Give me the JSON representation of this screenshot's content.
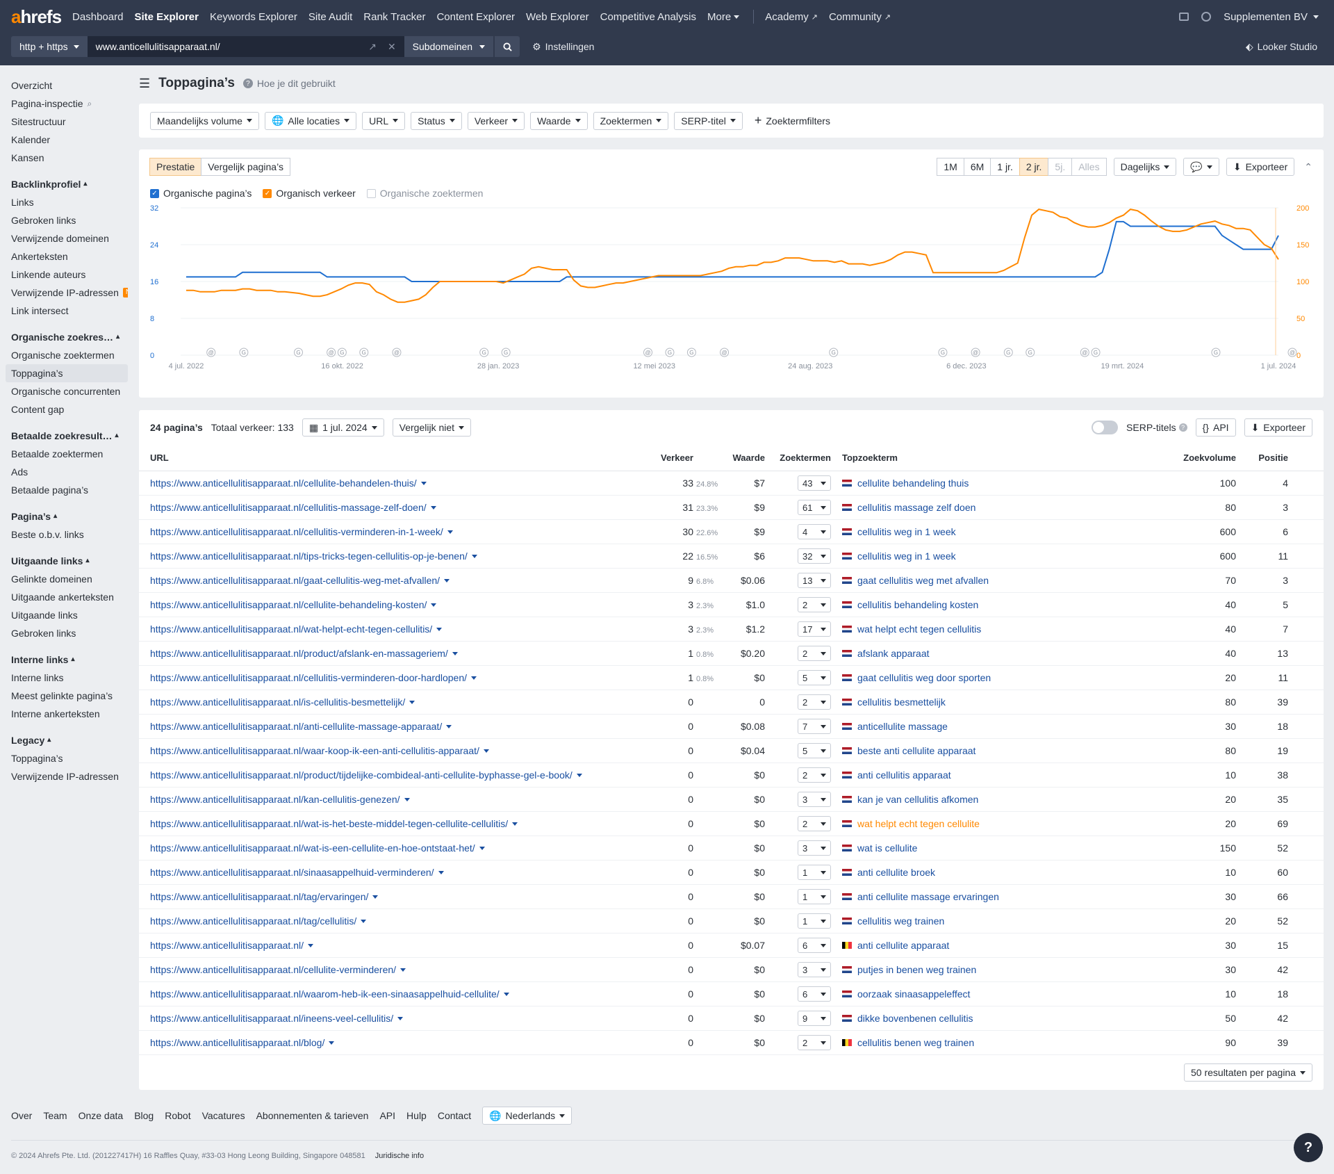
{
  "brand": {
    "logo_a": "a",
    "logo_rest": "hrefs"
  },
  "nav": {
    "items": [
      {
        "label": "Dashboard",
        "active": false
      },
      {
        "label": "Site Explorer",
        "active": true
      },
      {
        "label": "Keywords Explorer",
        "active": false
      },
      {
        "label": "Site Audit",
        "active": false
      },
      {
        "label": "Rank Tracker",
        "active": false
      },
      {
        "label": "Content Explorer",
        "active": false
      },
      {
        "label": "Web Explorer",
        "active": false
      },
      {
        "label": "Competitive Analysis",
        "active": false
      },
      {
        "label": "More",
        "active": false
      }
    ],
    "academy": "Academy",
    "community": "Community",
    "account": "Supplementen BV",
    "looker": "Looker Studio"
  },
  "searchbar": {
    "protocol": "http + https",
    "url": "www.anticellulitisapparaat.nl/",
    "mode": "Subdomeinen",
    "settings": "Instellingen"
  },
  "sidebar": [
    {
      "type": "item",
      "label": "Overzicht"
    },
    {
      "type": "item",
      "label": "Pagina-inspectie",
      "icon": "search"
    },
    {
      "type": "item",
      "label": "Sitestructuur"
    },
    {
      "type": "item",
      "label": "Kalender"
    },
    {
      "type": "item",
      "label": "Kansen"
    },
    {
      "type": "head",
      "label": "Backlinkprofiel"
    },
    {
      "type": "item",
      "label": "Links"
    },
    {
      "type": "item",
      "label": "Gebroken links"
    },
    {
      "type": "item",
      "label": "Verwijzende domeinen"
    },
    {
      "type": "item",
      "label": "Ankerteksten"
    },
    {
      "type": "item",
      "label": "Linkende auteurs"
    },
    {
      "type": "item",
      "label": "Verwijzende IP-adressen",
      "badge": "Nieuw"
    },
    {
      "type": "item",
      "label": "Link intersect"
    },
    {
      "type": "head",
      "label": "Organische zoekres…"
    },
    {
      "type": "item",
      "label": "Organische zoektermen"
    },
    {
      "type": "item",
      "label": "Toppagina’s",
      "selected": true
    },
    {
      "type": "item",
      "label": "Organische concurrenten"
    },
    {
      "type": "item",
      "label": "Content gap"
    },
    {
      "type": "head",
      "label": "Betaalde zoekresult…"
    },
    {
      "type": "item",
      "label": "Betaalde zoektermen"
    },
    {
      "type": "item",
      "label": "Ads"
    },
    {
      "type": "item",
      "label": "Betaalde pagina’s"
    },
    {
      "type": "head",
      "label": "Pagina’s"
    },
    {
      "type": "item",
      "label": "Beste o.b.v. links"
    },
    {
      "type": "head",
      "label": "Uitgaande links"
    },
    {
      "type": "item",
      "label": "Gelinkte domeinen"
    },
    {
      "type": "item",
      "label": "Uitgaande ankerteksten"
    },
    {
      "type": "item",
      "label": "Uitgaande links"
    },
    {
      "type": "item",
      "label": "Gebroken links"
    },
    {
      "type": "head",
      "label": "Interne links"
    },
    {
      "type": "item",
      "label": "Interne links"
    },
    {
      "type": "item",
      "label": "Meest gelinkte pagina’s"
    },
    {
      "type": "item",
      "label": "Interne ankerteksten"
    },
    {
      "type": "head",
      "label": "Legacy"
    },
    {
      "type": "item",
      "label": "Toppagina’s"
    },
    {
      "type": "item",
      "label": "Verwijzende IP-adressen"
    }
  ],
  "page": {
    "title": "Toppagina’s",
    "help": "Hoe je dit gebruikt"
  },
  "filters": [
    "Maandelijks volume",
    "Alle locaties",
    "URL",
    "Status",
    "Verkeer",
    "Waarde",
    "Zoektermen",
    "SERP-titel"
  ],
  "filter_add": "Zoektermfilters",
  "chart_panel": {
    "tabs": [
      "Prestatie",
      "Vergelijk pagina’s"
    ],
    "ranges": [
      {
        "l": "1M",
        "s": ""
      },
      {
        "l": "6M",
        "s": ""
      },
      {
        "l": "1 jr.",
        "s": ""
      },
      {
        "l": "2 jr.",
        "s": "on"
      },
      {
        "l": "5j.",
        "s": "dis"
      },
      {
        "l": "Alles",
        "s": "dis"
      }
    ],
    "interval": "Dagelijks",
    "export": "Exporteer",
    "legend": [
      {
        "label": "Organische pagina’s",
        "color": "#1f6fd0",
        "checked": true
      },
      {
        "label": "Organisch verkeer",
        "color": "#ff8800",
        "checked": true
      },
      {
        "label": "Organische zoektermen",
        "color": "#b3b8c0",
        "checked": false
      }
    ]
  },
  "chart_data": {
    "type": "line",
    "x_ticks": [
      "4 jul. 2022",
      "16 okt. 2022",
      "28 jan. 2023",
      "12 mei 2023",
      "24 aug. 2023",
      "6 dec. 2023",
      "19 mrt. 2024",
      "1 jul. 2024"
    ],
    "y_left_ticks": [
      "32",
      "24",
      "16",
      "8",
      "0"
    ],
    "y_right_ticks": [
      "200",
      "150",
      "100",
      "50",
      "0"
    ],
    "y_left_lim": [
      0,
      32
    ],
    "y_right_lim": [
      0,
      200
    ],
    "series": [
      {
        "name": "Organische pagina’s",
        "axis": "left",
        "color": "#1f6fd0",
        "values": [
          17,
          17,
          17,
          17,
          17,
          17,
          17,
          17,
          18,
          18,
          18,
          18,
          18,
          18,
          18,
          18,
          18,
          18,
          18,
          18,
          17,
          17,
          17,
          17,
          17,
          17,
          17,
          17,
          17,
          17,
          17,
          17,
          16,
          16,
          16,
          16,
          16,
          16,
          16,
          16,
          16,
          16,
          16,
          16,
          16,
          16,
          16,
          16,
          16,
          16,
          16,
          16,
          16,
          16,
          17,
          17,
          17,
          17,
          17,
          17,
          17,
          17,
          17,
          17,
          17,
          17,
          17,
          17,
          17,
          17,
          17,
          17,
          17,
          17,
          17,
          17,
          17,
          17,
          17,
          17,
          17,
          17,
          17,
          17,
          17,
          17,
          17,
          17,
          17,
          17,
          17,
          17,
          17,
          17,
          17,
          17,
          17,
          17,
          17,
          17,
          17,
          17,
          17,
          17,
          17,
          17,
          17,
          17,
          17,
          17,
          17,
          17,
          17,
          17,
          17,
          17,
          17,
          17,
          17,
          17,
          17,
          17,
          17,
          17,
          17,
          17,
          17,
          17,
          17,
          17,
          18,
          23,
          29,
          29,
          28,
          28,
          28,
          28,
          28,
          28,
          28,
          28,
          28,
          28,
          28,
          28,
          28,
          26,
          25,
          24,
          23,
          23,
          23,
          23,
          23,
          26
        ]
      },
      {
        "name": "Organisch verkeer",
        "axis": "right",
        "color": "#ff8800",
        "values": [
          88,
          88,
          86,
          86,
          86,
          88,
          88,
          88,
          90,
          90,
          88,
          88,
          88,
          86,
          86,
          85,
          84,
          82,
          80,
          80,
          82,
          86,
          90,
          95,
          98,
          98,
          96,
          86,
          82,
          76,
          72,
          72,
          74,
          76,
          82,
          92,
          100,
          100,
          100,
          100,
          100,
          100,
          100,
          100,
          100,
          98,
          102,
          106,
          110,
          118,
          120,
          118,
          116,
          116,
          116,
          102,
          94,
          92,
          92,
          94,
          96,
          98,
          98,
          100,
          102,
          104,
          106,
          108,
          108,
          108,
          108,
          108,
          108,
          108,
          110,
          112,
          114,
          118,
          120,
          120,
          122,
          122,
          126,
          126,
          128,
          132,
          132,
          132,
          130,
          128,
          128,
          128,
          126,
          128,
          124,
          124,
          124,
          122,
          124,
          126,
          130,
          136,
          140,
          140,
          138,
          136,
          112,
          112,
          112,
          112,
          112,
          112,
          112,
          112,
          112,
          112,
          115,
          120,
          125,
          160,
          190,
          198,
          196,
          194,
          188,
          186,
          180,
          176,
          174,
          174,
          176,
          180,
          186,
          190,
          198,
          196,
          190,
          182,
          175,
          170,
          168,
          168,
          170,
          174,
          178,
          180,
          182,
          178,
          176,
          172,
          172,
          170,
          160,
          150,
          145,
          130
        ]
      }
    ],
    "annotation_markers": "@ G"
  },
  "table": {
    "summary_count": "24 pagina’s",
    "summary_traffic": "Totaal verkeer: 133",
    "date": "1 jul. 2024",
    "compare": "Vergelijk niet",
    "serp_toggle": "SERP-titels",
    "api": "API",
    "export": "Exporteer",
    "columns": {
      "url": "URL",
      "traffic": "Verkeer",
      "value": "Waarde",
      "keywords": "Zoektermen",
      "top": "Topzoekterm",
      "volume": "Zoekvolume",
      "position": "Positie"
    },
    "rows": [
      {
        "url": "https://www.anticellulitisapparaat.nl/cellulite-behandelen-thuis/",
        "traffic": "33",
        "pct": "24.8%",
        "value": "$7",
        "kw": "43",
        "flag": "nl",
        "top": "cellulite behandeling thuis",
        "vol": "100",
        "pos": "4"
      },
      {
        "url": "https://www.anticellulitisapparaat.nl/cellulitis-massage-zelf-doen/",
        "traffic": "31",
        "pct": "23.3%",
        "value": "$9",
        "kw": "61",
        "flag": "nl",
        "top": "cellulitis massage zelf doen",
        "vol": "80",
        "pos": "3"
      },
      {
        "url": "https://www.anticellulitisapparaat.nl/cellulitis-verminderen-in-1-week/",
        "traffic": "30",
        "pct": "22.6%",
        "value": "$9",
        "kw": "4",
        "flag": "nl",
        "top": "cellulitis weg in 1 week",
        "vol": "600",
        "pos": "6"
      },
      {
        "url": "https://www.anticellulitisapparaat.nl/tips-tricks-tegen-cellulitis-op-je-benen/",
        "traffic": "22",
        "pct": "16.5%",
        "value": "$6",
        "kw": "32",
        "flag": "nl",
        "top": "cellulitis weg in 1 week",
        "vol": "600",
        "pos": "11"
      },
      {
        "url": "https://www.anticellulitisapparaat.nl/gaat-cellulitis-weg-met-afvallen/",
        "traffic": "9",
        "pct": "6.8%",
        "value": "$0.06",
        "kw": "13",
        "flag": "nl",
        "top": "gaat cellulitis weg met afvallen",
        "vol": "70",
        "pos": "3"
      },
      {
        "url": "https://www.anticellulitisapparaat.nl/cellulite-behandeling-kosten/",
        "traffic": "3",
        "pct": "2.3%",
        "value": "$1.0",
        "kw": "2",
        "flag": "nl",
        "top": "cellulitis behandeling kosten",
        "vol": "40",
        "pos": "5"
      },
      {
        "url": "https://www.anticellulitisapparaat.nl/wat-helpt-echt-tegen-cellulitis/",
        "traffic": "3",
        "pct": "2.3%",
        "value": "$1.2",
        "kw": "17",
        "flag": "nl",
        "top": "wat helpt echt tegen cellulitis",
        "vol": "40",
        "pos": "7"
      },
      {
        "url": "https://www.anticellulitisapparaat.nl/product/afslank-en-massageriem/",
        "traffic": "1",
        "pct": "0.8%",
        "value": "$0.20",
        "kw": "2",
        "flag": "nl",
        "top": "afslank apparaat",
        "vol": "40",
        "pos": "13"
      },
      {
        "url": "https://www.anticellulitisapparaat.nl/cellulitis-verminderen-door-hardlopen/",
        "traffic": "1",
        "pct": "0.8%",
        "value": "$0",
        "kw": "5",
        "flag": "nl",
        "top": "gaat cellulitis weg door sporten",
        "vol": "20",
        "pos": "11"
      },
      {
        "url": "https://www.anticellulitisapparaat.nl/is-cellulitis-besmettelijk/",
        "traffic": "0",
        "pct": "",
        "value": "0",
        "kw": "2",
        "flag": "nl",
        "top": "cellulitis besmettelijk",
        "vol": "80",
        "pos": "39"
      },
      {
        "url": "https://www.anticellulitisapparaat.nl/anti-cellulite-massage-apparaat/",
        "traffic": "0",
        "pct": "",
        "value": "$0.08",
        "kw": "7",
        "flag": "nl",
        "top": "anticellulite massage",
        "vol": "30",
        "pos": "18"
      },
      {
        "url": "https://www.anticellulitisapparaat.nl/waar-koop-ik-een-anti-cellulitis-apparaat/",
        "traffic": "0",
        "pct": "",
        "value": "$0.04",
        "kw": "5",
        "flag": "nl",
        "top": "beste anti cellulite apparaat",
        "vol": "80",
        "pos": "19"
      },
      {
        "url": "https://www.anticellulitisapparaat.nl/product/tijdelijke-combideal-anti-cellulite-byphasse-gel-e-book/",
        "traffic": "0",
        "pct": "",
        "value": "$0",
        "kw": "2",
        "flag": "nl",
        "top": "anti cellulitis apparaat",
        "vol": "10",
        "pos": "38"
      },
      {
        "url": "https://www.anticellulitisapparaat.nl/kan-cellulitis-genezen/",
        "traffic": "0",
        "pct": "",
        "value": "$0",
        "kw": "3",
        "flag": "nl",
        "top": "kan je van cellulitis afkomen",
        "vol": "20",
        "pos": "35"
      },
      {
        "url": "https://www.anticellulitisapparaat.nl/wat-is-het-beste-middel-tegen-cellulite-cellulitis/",
        "traffic": "0",
        "pct": "",
        "value": "$0",
        "kw": "2",
        "flag": "nl",
        "top": "wat helpt echt tegen cellulite",
        "vol": "20",
        "pos": "69",
        "orange": true
      },
      {
        "url": "https://www.anticellulitisapparaat.nl/wat-is-een-cellulite-en-hoe-ontstaat-het/",
        "traffic": "0",
        "pct": "",
        "value": "$0",
        "kw": "3",
        "flag": "nl",
        "top": "wat is cellulite",
        "vol": "150",
        "pos": "52"
      },
      {
        "url": "https://www.anticellulitisapparaat.nl/sinaasappelhuid-verminderen/",
        "traffic": "0",
        "pct": "",
        "value": "$0",
        "kw": "1",
        "flag": "nl",
        "top": "anti cellulite broek",
        "vol": "10",
        "pos": "60"
      },
      {
        "url": "https://www.anticellulitisapparaat.nl/tag/ervaringen/",
        "traffic": "0",
        "pct": "",
        "value": "$0",
        "kw": "1",
        "flag": "nl",
        "top": "anti cellulite massage ervaringen",
        "vol": "30",
        "pos": "66"
      },
      {
        "url": "https://www.anticellulitisapparaat.nl/tag/cellulitis/",
        "traffic": "0",
        "pct": "",
        "value": "$0",
        "kw": "1",
        "flag": "nl",
        "top": "cellulitis weg trainen",
        "vol": "20",
        "pos": "52"
      },
      {
        "url": "https://www.anticellulitisapparaat.nl/",
        "traffic": "0",
        "pct": "",
        "value": "$0.07",
        "kw": "6",
        "flag": "be",
        "top": "anti cellulite apparaat",
        "vol": "30",
        "pos": "15"
      },
      {
        "url": "https://www.anticellulitisapparaat.nl/cellulite-verminderen/",
        "traffic": "0",
        "pct": "",
        "value": "$0",
        "kw": "3",
        "flag": "nl",
        "top": "putjes in benen weg trainen",
        "vol": "30",
        "pos": "42"
      },
      {
        "url": "https://www.anticellulitisapparaat.nl/waarom-heb-ik-een-sinaasappelhuid-cellulite/",
        "traffic": "0",
        "pct": "",
        "value": "$0",
        "kw": "6",
        "flag": "nl",
        "top": "oorzaak sinaasappeleffect",
        "vol": "10",
        "pos": "18"
      },
      {
        "url": "https://www.anticellulitisapparaat.nl/ineens-veel-cellulitis/",
        "traffic": "0",
        "pct": "",
        "value": "$0",
        "kw": "9",
        "flag": "nl",
        "top": "dikke bovenbenen cellulitis",
        "vol": "50",
        "pos": "42"
      },
      {
        "url": "https://www.anticellulitisapparaat.nl/blog/",
        "traffic": "0",
        "pct": "",
        "value": "$0",
        "kw": "2",
        "flag": "be",
        "top": "cellulitis benen weg trainen",
        "vol": "90",
        "pos": "39"
      }
    ],
    "per_page": "50 resultaten per pagina"
  },
  "footer": {
    "links": [
      "Over",
      "Team",
      "Onze data",
      "Blog",
      "Robot",
      "Vacatures",
      "Abonnementen & tarieven",
      "API",
      "Hulp",
      "Contact"
    ],
    "lang": "Nederlands",
    "copyright": "© 2024 Ahrefs Pte. Ltd. (201227417H) 16 Raffles Quay, #33-03 Hong Leong Building, Singapore 048581",
    "legal": "Juridische info",
    "help": "?"
  }
}
